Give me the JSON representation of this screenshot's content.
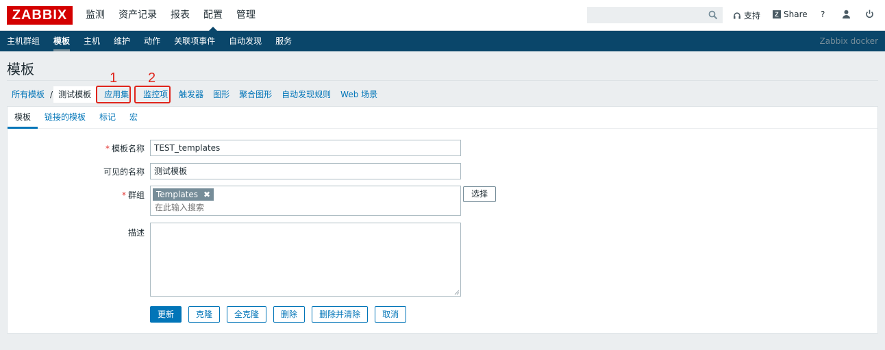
{
  "header": {
    "logo": "ZABBIX",
    "menu": [
      "监测",
      "资产记录",
      "报表",
      "配置",
      "管理"
    ],
    "active_menu_index": 3,
    "search_placeholder": "",
    "support_label": "支持",
    "share_label": "Share",
    "help_label": "?"
  },
  "subnav": {
    "items": [
      "主机群组",
      "模板",
      "主机",
      "维护",
      "动作",
      "关联项事件",
      "自动发现",
      "服务"
    ],
    "active_index": 1,
    "server_name": "Zabbix docker"
  },
  "page": {
    "title": "模板"
  },
  "breadcrumb": {
    "all": "所有模板",
    "separator": "/",
    "current": "测试模板",
    "links": [
      "应用集",
      "监控项",
      "触发器",
      "图形",
      "聚合图形",
      "自动发现规则",
      "Web 场景"
    ]
  },
  "annotations": {
    "one": "1",
    "two": "2",
    "color": "#e0251c"
  },
  "tabs": [
    "模板",
    "链接的模板",
    "标记",
    "宏"
  ],
  "form": {
    "required_mark": "*",
    "name_label": "模板名称",
    "name_value": "TEST_templates",
    "visible_label": "可见的名称",
    "visible_value": "测试模板",
    "groups_label": "群组",
    "group_tag": "Templates",
    "group_tag_remove": "✖",
    "groups_placeholder": "在此输入搜索",
    "select_label": "选择",
    "desc_label": "描述",
    "desc_value": ""
  },
  "buttons": {
    "update": "更新",
    "clone": "克隆",
    "full_clone": "全克隆",
    "delete": "删除",
    "delete_clear": "删除并清除",
    "cancel": "取消"
  },
  "colors": {
    "nav_bg": "#0a466a",
    "logo_bg": "#d40000",
    "link": "#0275b8"
  }
}
